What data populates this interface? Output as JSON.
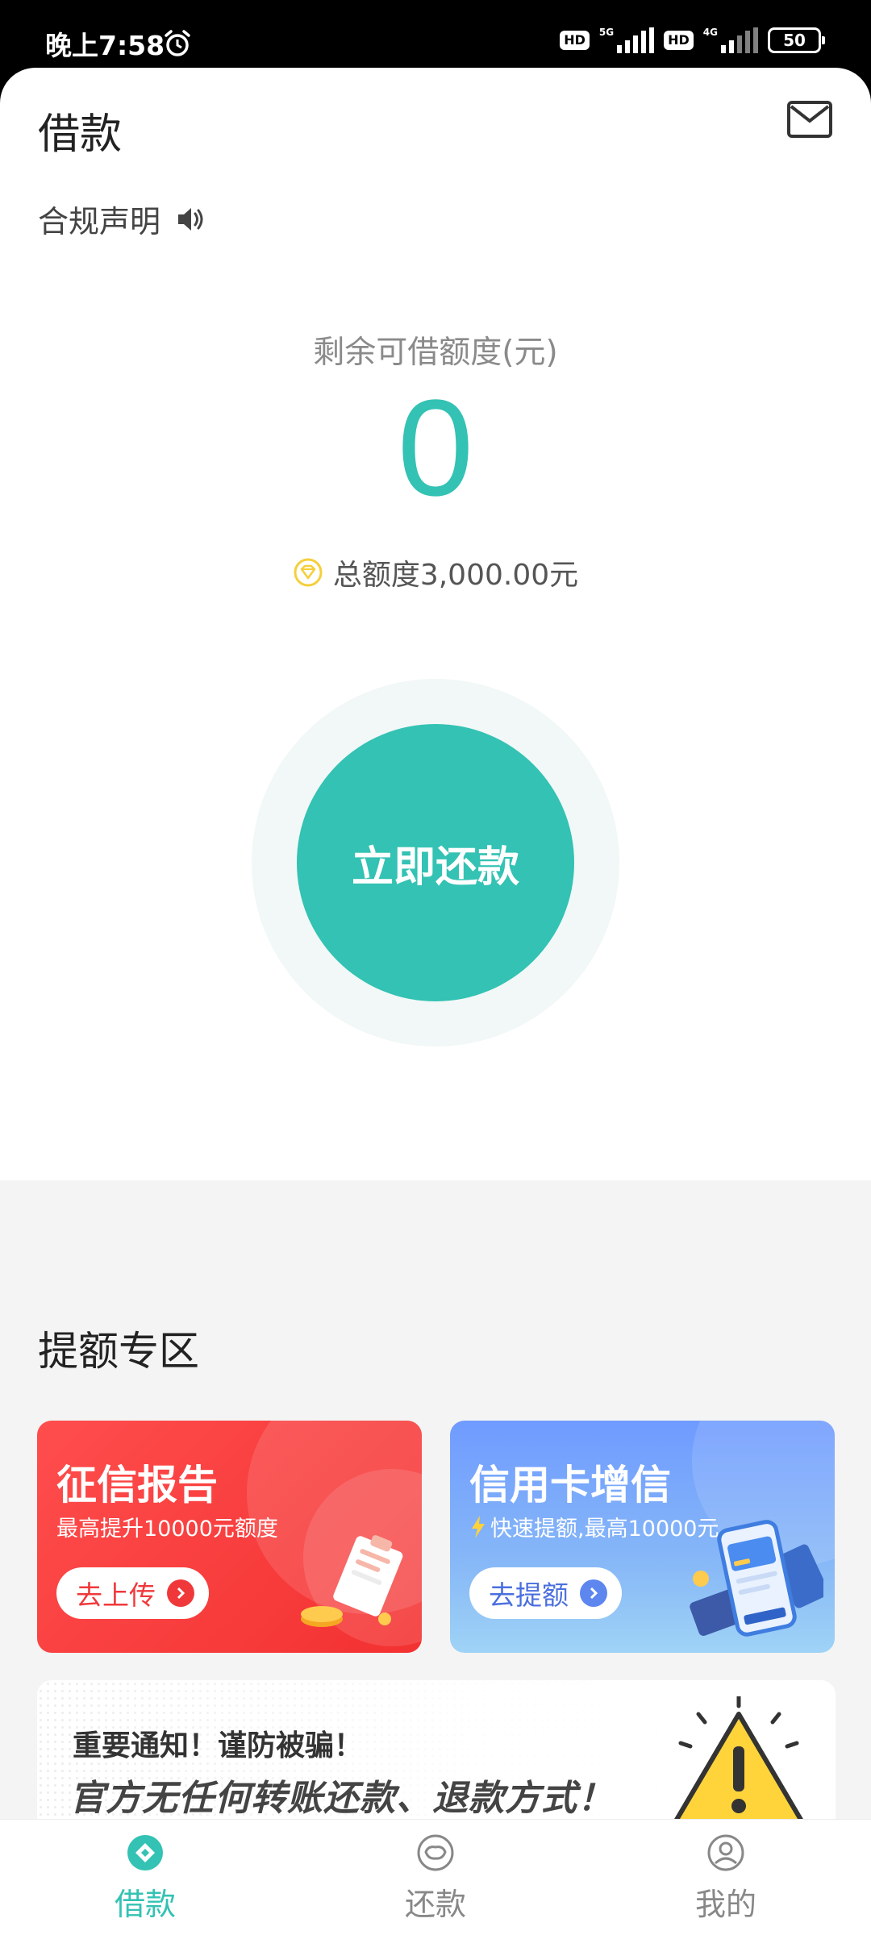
{
  "status_bar": {
    "time": "晚上7:58",
    "hd1": "HD",
    "net1": "5G",
    "hd2": "HD",
    "net2": "4G",
    "battery": "50"
  },
  "header": {
    "title": "借款",
    "mail_icon": "mail-icon"
  },
  "notice": {
    "text": "合规声明",
    "icon": "speaker-icon"
  },
  "quota": {
    "label": "剩余可借额度(元)",
    "value": "0",
    "total_text": "总额度3,000.00元",
    "accent_color": "#33c2b3"
  },
  "main_action": {
    "label": "立即还款"
  },
  "promo": {
    "section_title": "提额专区",
    "cards": [
      {
        "title": "征信报告",
        "subtitle": "最高提升10000元额度",
        "button": "去上传",
        "color": "#f33131"
      },
      {
        "title": "信用卡增信",
        "subtitle": "快速提额,最高10000元",
        "button": "去提额",
        "color": "#6f9bff"
      }
    ]
  },
  "banner": {
    "line1": "重要通知！谨防被骗！",
    "line2": "官方无任何转账还款、退款方式！",
    "icon": "warning-icon"
  },
  "bottom_nav": {
    "items": [
      {
        "label": "借款",
        "icon": "loan-icon",
        "active": true
      },
      {
        "label": "还款",
        "icon": "repay-icon",
        "active": false
      },
      {
        "label": "我的",
        "icon": "profile-icon",
        "active": false
      }
    ]
  }
}
